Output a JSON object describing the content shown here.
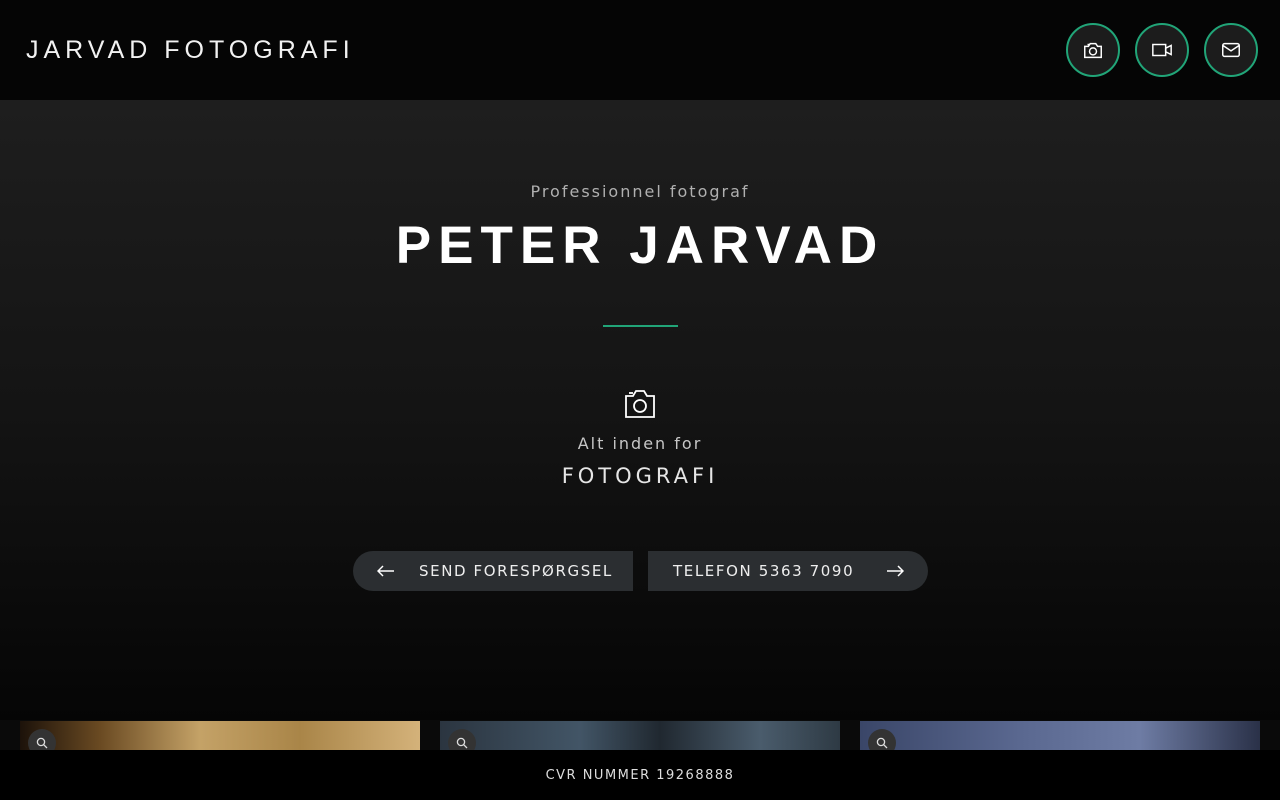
{
  "header": {
    "brand": "JARVAD FOTOGRAFI",
    "nav": [
      {
        "icon": "camera-icon"
      },
      {
        "icon": "video-camera-icon"
      },
      {
        "icon": "envelope-icon"
      }
    ]
  },
  "hero": {
    "eyebrow": "Professionnel fotograf",
    "title": "PETER JARVAD",
    "service_icon": "camera-icon",
    "kicker": "Alt inden for",
    "service": "FOTOGRAFI",
    "buttons": {
      "left_label": "SEND FORESPØRGSEL",
      "left_icon": "arrow-left-icon",
      "right_label": "TELEFON 5363 7090",
      "right_icon": "arrow-right-icon"
    }
  },
  "gallery": {
    "items": [
      {
        "icon": "search-icon"
      },
      {
        "icon": "search-icon"
      },
      {
        "icon": "search-icon"
      }
    ]
  },
  "footer": {
    "text": "CVR NUMMER 19268888"
  },
  "colors": {
    "accent": "#21a578",
    "header_bg": "#050505",
    "button_bg": "#2b2e31",
    "footer_bg": "#000000"
  }
}
